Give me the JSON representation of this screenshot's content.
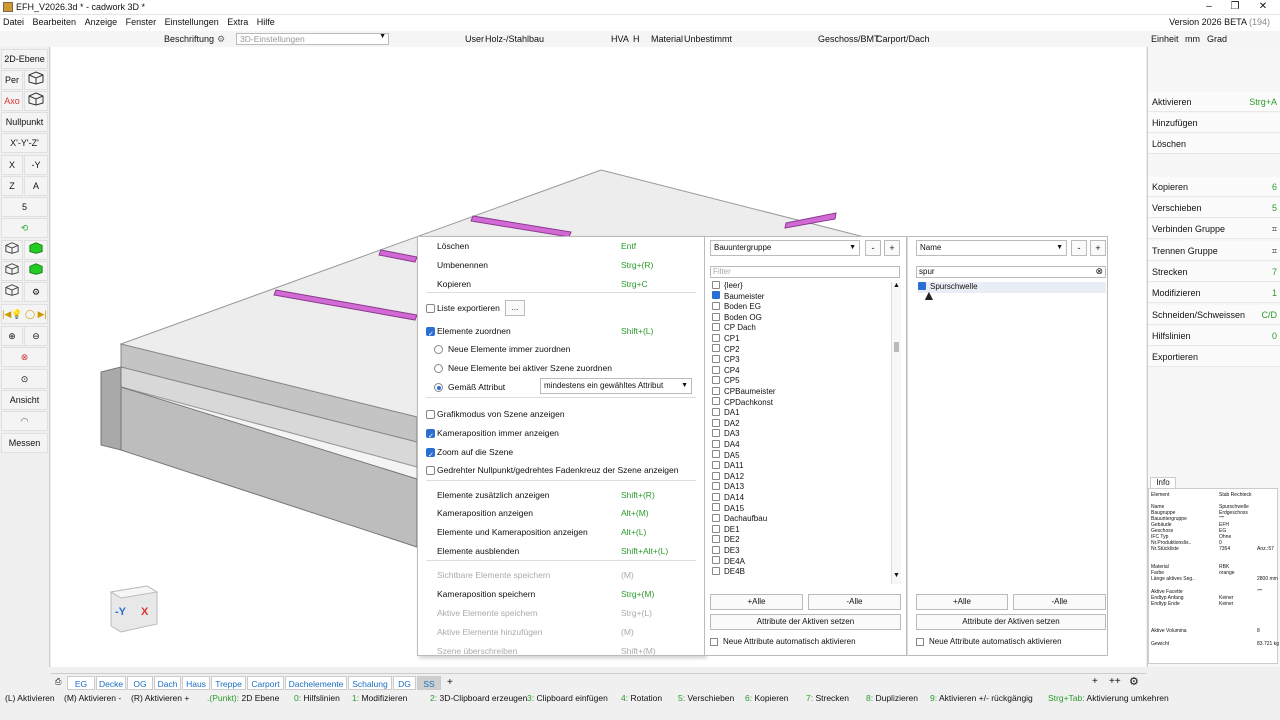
{
  "window": {
    "title": "EFH_V2026.3d * - cadwork 3D *",
    "version": "Version 2026 BETA",
    "build": "(194)"
  },
  "menu": [
    "Datei",
    "Bearbeiten",
    "Anzeige",
    "Fenster",
    "Einstellungen",
    "Extra",
    "Hilfe"
  ],
  "toolbar": {
    "beschriftung": "Beschriftung",
    "settings3d": "3D-Einstellungen",
    "user_label": "User",
    "user_value": "Holz-/Stahlbau",
    "hva_label": "HVA",
    "hva_value": "H",
    "material_label": "Material",
    "material_value": "Unbestimmt",
    "geschoss_label": "Geschoss/BMT",
    "geschoss_value": "Carport/Dach",
    "einheit_label": "Einheit",
    "einheit_mm": "mm",
    "einheit_grad": "Grad"
  },
  "left": {
    "ebene": "2D-Ebene",
    "per": "Per",
    "axo": "Axo",
    "nullpunkt": "Nullpunkt",
    "xyz": "X'-Y'-Z'",
    "x": "X",
    "my": "-Y",
    "z": "Z",
    "a": "A",
    "five": "5",
    "ansicht": "Ansicht",
    "messen": "Messen"
  },
  "right": {
    "items": [
      {
        "label": "Aktivieren",
        "shortcut": "Strg+A"
      },
      {
        "label": "Hinzufügen",
        "shortcut": ""
      },
      {
        "label": "Löschen",
        "shortcut": ""
      },
      {
        "label": "Kopieren",
        "shortcut": "6"
      },
      {
        "label": "Verschieben",
        "shortcut": "5"
      },
      {
        "label": "Verbinden Gruppe",
        "shortcut": ""
      },
      {
        "label": "Trennen Gruppe",
        "shortcut": ""
      },
      {
        "label": "Strecken",
        "shortcut": "7"
      },
      {
        "label": "Modifizieren",
        "shortcut": "1"
      },
      {
        "label": "Schneiden/Schweissen",
        "shortcut": "C/D"
      },
      {
        "label": "Hilfslinien",
        "shortcut": "0"
      },
      {
        "label": "Exportieren",
        "shortcut": ""
      }
    ],
    "info_tab": "Info",
    "info_rows": [
      [
        "Element",
        "Stab Rechteck",
        ""
      ],
      [
        "Name",
        "Spurschwelle",
        ""
      ],
      [
        "Baugruppe",
        "Erdgeschoss",
        ""
      ],
      [
        "Bauuntergruppe",
        "\"\"\"",
        ""
      ],
      [
        "Gebäude",
        "EFH",
        ""
      ],
      [
        "Geschoss",
        "EG",
        ""
      ],
      [
        "IFC Typ",
        "Ohne",
        ""
      ],
      [
        "Nr.Produktionslis..",
        "0",
        ""
      ],
      [
        "Nr.Stückliste",
        "7354",
        "Anz.:57"
      ],
      [
        "Material",
        "RBK",
        ""
      ],
      [
        "Farbe",
        "orange",
        ""
      ],
      [
        "Länge aktives Seg..",
        "",
        "2800 mm"
      ],
      [
        "Aktive Facette",
        "",
        "\"\"\""
      ],
      [
        "Endtyp Anfang",
        "Keiner",
        ""
      ],
      [
        "Endtyp Ende",
        "Keiner",
        ""
      ],
      [
        "Aktive Volumina",
        "",
        "8"
      ],
      [
        "Gewicht",
        "",
        "83.721 kg"
      ]
    ]
  },
  "context_menu": {
    "items": [
      {
        "label": "Löschen",
        "shortcut": "Entf",
        "type": "plain"
      },
      {
        "label": "Umbenennen",
        "shortcut": "Strg+(R)",
        "type": "plain"
      },
      {
        "label": "Kopieren",
        "shortcut": "Strg+C",
        "type": "plain"
      },
      {
        "label": "Liste exportieren",
        "shortcut": "",
        "type": "check",
        "checked": false
      },
      {
        "label": "Elemente zuordnen",
        "shortcut": "Shift+(L)",
        "type": "check",
        "checked": true
      },
      {
        "label": "Neue Elemente immer zuordnen",
        "shortcut": "",
        "type": "radio",
        "checked": false
      },
      {
        "label": "Neue Elemente bei aktiver Szene zuordnen",
        "shortcut": "",
        "type": "radio",
        "checked": false
      },
      {
        "label": "Gemäß Attribut",
        "shortcut": "",
        "type": "radio",
        "checked": true
      },
      {
        "label": "Grafikmodus von Szene anzeigen",
        "shortcut": "",
        "type": "check",
        "checked": false
      },
      {
        "label": "Kameraposition immer anzeigen",
        "shortcut": "",
        "type": "check",
        "checked": true
      },
      {
        "label": "Zoom auf die Szene",
        "shortcut": "",
        "type": "check",
        "checked": true
      },
      {
        "label": "Gedrehter Nullpunkt/gedrehtes Fadenkreuz der Szene anzeigen",
        "shortcut": "",
        "type": "check",
        "checked": false
      },
      {
        "label": "Elemente zusätzlich anzeigen",
        "shortcut": "Shift+(R)",
        "type": "plain"
      },
      {
        "label": "Kameraposition anzeigen",
        "shortcut": "Alt+(M)",
        "type": "plain"
      },
      {
        "label": "Elemente und Kameraposition anzeigen",
        "shortcut": "Alt+(L)",
        "type": "plain"
      },
      {
        "label": "Elemente ausblenden",
        "shortcut": "Shift+Alt+(L)",
        "type": "plain"
      },
      {
        "label": "Sichtbare Elemente speichern",
        "shortcut": "(M)",
        "type": "disabled"
      },
      {
        "label": "Kameraposition speichern",
        "shortcut": "Strg+(M)",
        "type": "plain"
      },
      {
        "label": "Aktive Elemente speichern",
        "shortcut": "Strg+(L)",
        "type": "disabled"
      },
      {
        "label": "Aktive Elemente hinzufügen",
        "shortcut": "(M)",
        "type": "disabled"
      },
      {
        "label": "Szene überschreiben",
        "shortcut": "Shift+(M)",
        "type": "disabled"
      }
    ],
    "attribute_select": "mindestens ein gewähltes Attribut",
    "dots": "..."
  },
  "list1": {
    "select": "Bauuntergruppe",
    "filter_placeholder": "Filter",
    "entries": [
      "{leer}",
      "Baumeister",
      "Boden EG",
      "Boden OG",
      "CP Dach",
      "CP1",
      "CP2",
      "CP3",
      "CP4",
      "CP5",
      "CPBaumeister",
      "CPDachkonst",
      "DA1",
      "DA2",
      "DA3",
      "DA4",
      "DA5",
      "DA11",
      "DA12",
      "DA13",
      "DA14",
      "DA15",
      "Dachaufbau",
      "DE1",
      "DE2",
      "DE3",
      "DE4A",
      "DE4B"
    ],
    "checked_index": 1,
    "all_add": "+Alle",
    "all_remove": "-Alle",
    "set_attr": "Attribute der Aktiven setzen",
    "auto": "Neue Attribute automatisch aktivieren"
  },
  "list2": {
    "select": "Name",
    "filter_value": "spur",
    "entries": [
      "Spurschwelle"
    ],
    "all_add": "+Alle",
    "all_remove": "-Alle",
    "set_attr": "Attribute der Aktiven setzen",
    "auto": "Neue Attribute automatisch aktivieren"
  },
  "viewcube": {
    "y": "-Y",
    "x": "X"
  },
  "tabs": [
    "EG",
    "Decke",
    "OG",
    "Dach",
    "Haus",
    "Treppe",
    "Carport",
    "Dachelemente",
    "Schalung",
    "DG",
    "SS"
  ],
  "tab_add": "+",
  "tab_right": [
    "+",
    "++"
  ],
  "status": [
    {
      "k": "(L) Aktivieren",
      "g": false
    },
    {
      "k": "(M) Aktivieren -",
      "g": false
    },
    {
      "k": "(R) Aktivieren +",
      "g": false
    },
    {
      "k": ".(Punkt):",
      "v": "2D Ebene"
    },
    {
      "k": "0:",
      "v": "Hilfslinien"
    },
    {
      "k": "1:",
      "v": "Modifizieren"
    },
    {
      "k": "2:",
      "v": "3D-Clipboard erzeugen"
    },
    {
      "k": "3:",
      "v": "Clipboard einfügen"
    },
    {
      "k": "4:",
      "v": "Rotation"
    },
    {
      "k": "5:",
      "v": "Verschieben"
    },
    {
      "k": "6:",
      "v": "Kopieren"
    },
    {
      "k": "7:",
      "v": "Strecken"
    },
    {
      "k": "8:",
      "v": "Duplizieren"
    },
    {
      "k": "9:",
      "v": "Aktivieren +/- rückgängig"
    },
    {
      "k": "Strg+Tab:",
      "v": "Aktivierung umkehren"
    }
  ],
  "colors": {
    "accent": "#2b6fd3",
    "shortcut": "#2a9a2a",
    "tab": "#1a6fc0",
    "beam": "#d26ad6"
  }
}
